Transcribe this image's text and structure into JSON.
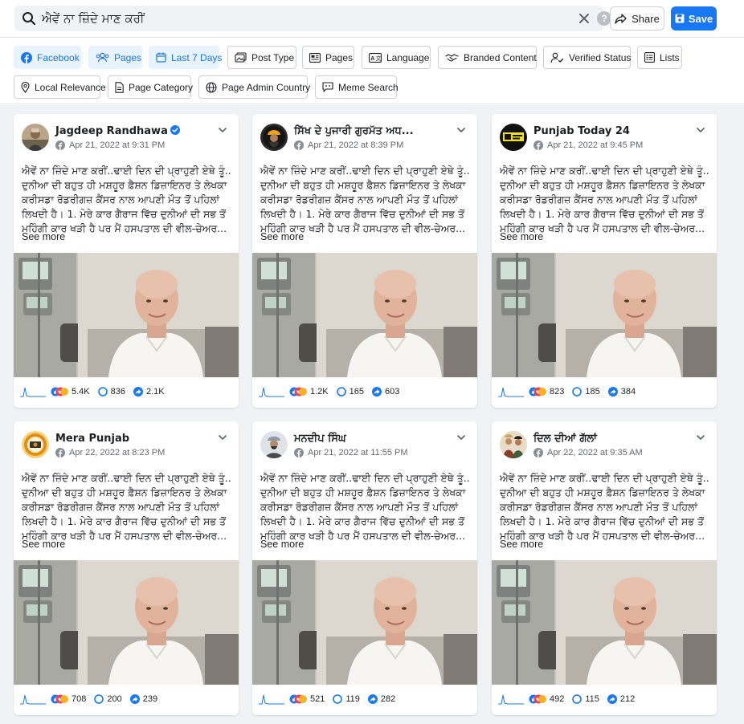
{
  "search": {
    "query": "ਐਵੇਂ ਨਾ ਜ਼ਿੰਦੇ ਮਾਣ ਕਰੀਂ"
  },
  "toolbar": {
    "share_label": "Share",
    "save_label": "Save"
  },
  "filters": [
    {
      "label": "Facebook",
      "icon": "facebook-icon",
      "active": true
    },
    {
      "label": "Pages",
      "icon": "pages-icon",
      "active": true
    },
    {
      "label": "Last 7 Days",
      "icon": "calendar-icon",
      "active": true
    },
    {
      "label": "Post Type",
      "icon": "post-type-icon",
      "active": false
    },
    {
      "label": "Pages",
      "icon": "pages-list-icon",
      "active": false
    },
    {
      "label": "Language",
      "icon": "language-icon",
      "active": false
    },
    {
      "label": "Branded Content",
      "icon": "handshake-icon",
      "active": false
    },
    {
      "label": "Verified Status",
      "icon": "verified-user-icon",
      "active": false
    },
    {
      "label": "Lists",
      "icon": "list-icon",
      "active": false
    },
    {
      "label": "Local Relevance",
      "icon": "location-pin-icon",
      "active": false
    },
    {
      "label": "Page Category",
      "icon": "page-category-icon",
      "active": false
    },
    {
      "label": "Page Admin Country",
      "icon": "globe-icon",
      "active": false
    },
    {
      "label": "Meme Search",
      "icon": "meme-search-icon",
      "active": false
    }
  ],
  "post_text": [
    "ਐਵੇਂ ਨਾ ਜ਼ਿੰਦੇ ਮਾਣ ਕਰੀਂ..ਢਾਈ ਦਿਨ ਦੀ ਪ੍ਰਾਹੁਣੀ ਏਥੇ ਤੂੰ..",
    "ਦੁਨੀਆ ਦੀ ਬਹੁਤ ਹੀ ਮਸ਼ਹੂਰ ਫ਼ੈਸ਼ਨ ਡਿਜ਼ਾਇਨਰ ਤੇ ਲੇਖਕਾ",
    "ਕਰੀਸਡਾ ਰੋਡਰੀਗਜ਼ ਕੈਂਸਰ ਨਾਲ ਆਪਣੀ ਮੌਤ ਤੋਂ ਪਹਿਲਾਂ",
    "ਲਿਖਦੀ ਹੈ। 1. ਮੇਰੇ ਕਾਰ ਗੈਰਾਜ ਵਿੱਚ ਦੁਨੀਆਂ ਦੀ ਸਭ ਤੋਂ",
    "ਮਹਿੰਗੀ ਕਾਰ ਖੜੀ ਹੈ ਪਰ ਮੈਂ ਹਸਪਤਾਲ ਦੀ ਵੀਲ-ਚੇਅਰ..."
  ],
  "see_more_label": "See more",
  "colors": {
    "accent": "#1877f2",
    "chip_active_bg": "#e7f3ff",
    "background": "#f0f2f5"
  },
  "posts": [
    {
      "author": "Jagdeep Randhawa",
      "verified": true,
      "date": "Apr 21, 2022 at 9:31 PM",
      "reactions": "5.4K",
      "comments": "836",
      "shares": "2.1K"
    },
    {
      "author": "ਸਿੱਖ ਦੇ ਪੁਜਾਰੀ ਗੁਰਮੱਤ ਅਧ...",
      "verified": false,
      "date": "Apr 21, 2022 at 8:39 PM",
      "reactions": "1.2K",
      "comments": "165",
      "shares": "603"
    },
    {
      "author": "Punjab Today 24",
      "verified": false,
      "date": "Apr 21, 2022 at 9:45 PM",
      "reactions": "823",
      "comments": "185",
      "shares": "384"
    },
    {
      "author": "Mera Punjab",
      "verified": false,
      "date": "Apr 22, 2022 at 8:23 PM",
      "reactions": "708",
      "comments": "200",
      "shares": "239"
    },
    {
      "author": "ਮਨਦੀਪ ਸਿੰਘ",
      "verified": false,
      "date": "Apr 21, 2022 at 11:55 PM",
      "reactions": "521",
      "comments": "119",
      "shares": "282"
    },
    {
      "author": "ਦਿਲ ਦੀਆਂ ਗੱਲਾਂ",
      "verified": false,
      "date": "Apr 22, 2022 at 9:35 AM",
      "reactions": "492",
      "comments": "115",
      "shares": "212"
    }
  ]
}
